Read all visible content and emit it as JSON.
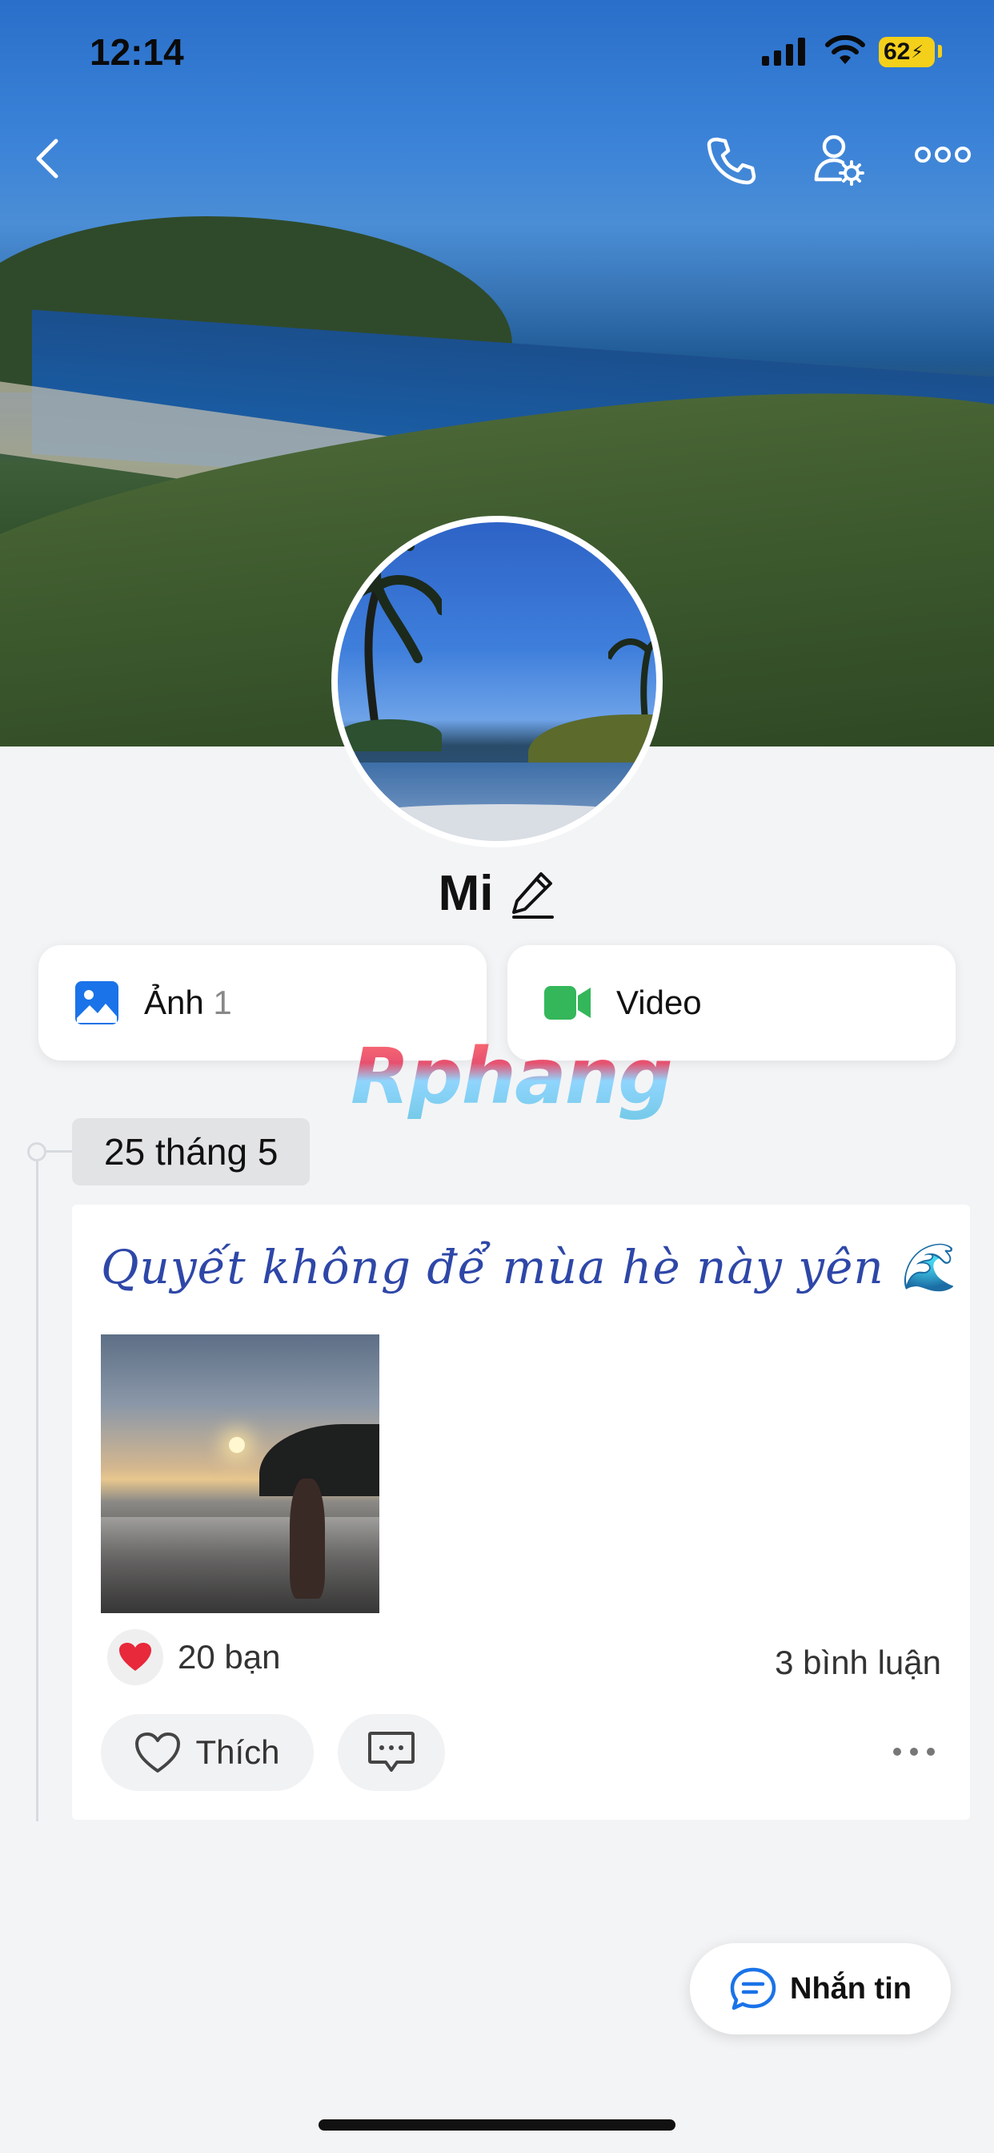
{
  "status_bar": {
    "time": "12:14",
    "battery": "62"
  },
  "header": {
    "icons": [
      "back-icon",
      "phone-icon",
      "profile-settings-icon",
      "more-icon"
    ]
  },
  "profile": {
    "name": "Mi"
  },
  "media": {
    "photos_label": "Ảnh",
    "photos_count": "1",
    "video_label": "Video"
  },
  "watermark": "Rphang",
  "timeline": {
    "date": "25 tháng 5",
    "post": {
      "text": "Quyết không để mùa hè này yên 🌊",
      "reactions": "20 bạn",
      "comments": "3 bình luận",
      "like_label": "Thích"
    }
  },
  "message_button": {
    "label": "Nhắn tin"
  },
  "colors": {
    "accent": "#1a73e8",
    "post_text": "#2e47a8",
    "heart": "#e8283b",
    "video_icon": "#34b75a"
  }
}
